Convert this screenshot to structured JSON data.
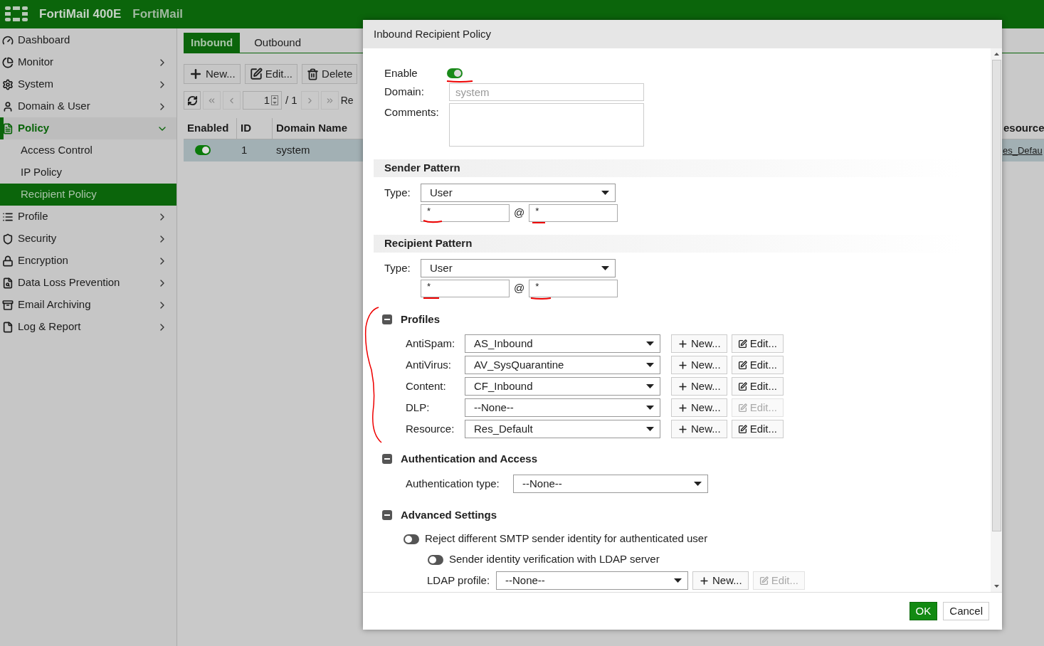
{
  "header": {
    "product": "FortiMail 400E",
    "name": "FortiMail"
  },
  "sidebar": {
    "items": [
      {
        "label": "Dashboard",
        "selected": false
      },
      {
        "label": "Monitor",
        "selected": false,
        "expanded": false
      },
      {
        "label": "System",
        "selected": false,
        "expanded": false
      },
      {
        "label": "Domain & User",
        "selected": false,
        "expanded": false
      },
      {
        "label": "Policy",
        "selected": true,
        "expanded": true,
        "children": [
          {
            "label": "Access Control",
            "selected": false
          },
          {
            "label": "IP Policy",
            "selected": false
          },
          {
            "label": "Recipient Policy",
            "selected": true
          }
        ]
      },
      {
        "label": "Profile",
        "selected": false,
        "expanded": false
      },
      {
        "label": "Security",
        "selected": false,
        "expanded": false
      },
      {
        "label": "Encryption",
        "selected": false,
        "expanded": false
      },
      {
        "label": "Data Loss Prevention",
        "selected": false,
        "expanded": false
      },
      {
        "label": "Email Archiving",
        "selected": false,
        "expanded": false
      },
      {
        "label": "Log & Report",
        "selected": false,
        "expanded": false
      }
    ]
  },
  "tabs": [
    {
      "label": "Inbound",
      "selected": true
    },
    {
      "label": "Outbound",
      "selected": false
    }
  ],
  "toolbar": [
    "New...",
    "Edit...",
    "Delete"
  ],
  "pager": {
    "page": "1",
    "total": "/ 1",
    "column_label": "Re"
  },
  "table": {
    "columns": [
      "Enabled",
      "ID",
      "Domain Name",
      "esource"
    ],
    "rows": [
      {
        "enabled": true,
        "selected": true,
        "id": "1",
        "domain": "system",
        "column_4": "es_Defau"
      }
    ]
  },
  "dialog": {
    "title": "Inbound Recipient Policy",
    "enable": {
      "label": "Enable",
      "on": true
    },
    "domain": {
      "label": "Domain:",
      "placeholder": "system"
    },
    "comments": {
      "label": "Comments:"
    },
    "patterns": [
      {
        "title": "Sender Pattern",
        "type_label": "Type:",
        "type": "User",
        "local": "*",
        "at": "@",
        "domain": "*"
      },
      {
        "title": "Recipient Pattern",
        "type_label": "Type:",
        "type": "User",
        "local": "*",
        "at": "@",
        "domain": "*"
      }
    ],
    "profiles": {
      "title": "Profiles",
      "expanded": true,
      "rows": [
        {
          "label": "AntiSpam:",
          "value": "AS_Inbound",
          "new": "New...",
          "edit": "Edit...",
          "edit_disabled": false
        },
        {
          "label": "AntiVirus:",
          "value": "AV_SysQuarantine",
          "new": "New...",
          "edit": "Edit...",
          "edit_disabled": false
        },
        {
          "label": "Content:",
          "value": "CF_Inbound",
          "new": "New...",
          "edit": "Edit...",
          "edit_disabled": false
        },
        {
          "label": "DLP:",
          "value": "--None--",
          "new": "New...",
          "edit": "Edit...",
          "edit_disabled": true
        },
        {
          "label": "Resource:",
          "value": "Res_Default",
          "new": "New...",
          "edit": "Edit...",
          "edit_disabled": false
        }
      ]
    },
    "auth": {
      "title": "Authentication and Access",
      "expanded": true,
      "label": "Authentication type:",
      "value": "--None--"
    },
    "advanced": {
      "title": "Advanced Settings",
      "expanded": true,
      "toggles": [
        {
          "label": "Reject different SMTP sender identity for authenticated user",
          "on": false
        },
        {
          "label": "Sender identity verification with LDAP server",
          "on": false
        }
      ],
      "ldap": {
        "label": "LDAP profile:",
        "value": "--None--",
        "new": "New...",
        "edit": "Edit...",
        "edit_disabled": true
      }
    },
    "buttons": [
      {
        "label": "OK",
        "primary": true
      },
      {
        "label": "Cancel",
        "primary": false
      }
    ]
  }
}
